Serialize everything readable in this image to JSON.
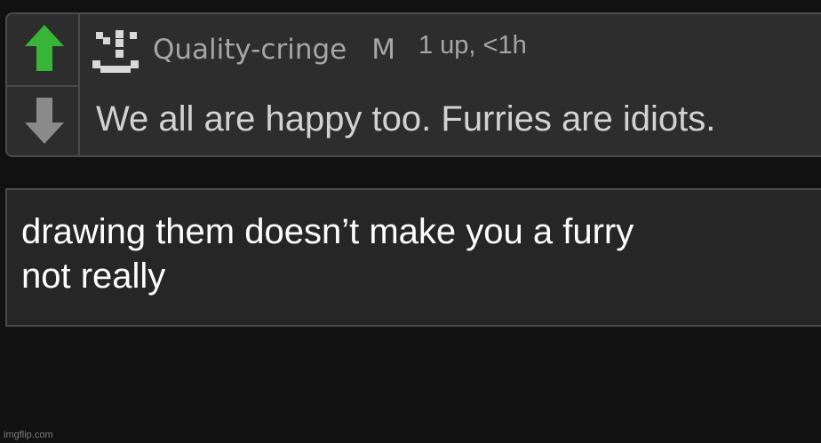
{
  "colors": {
    "background": "#111111",
    "panel": "#2d2d2d",
    "border": "#4a4a4a",
    "upvote_arrow": "#38b536",
    "downvote_arrow": "#8a8a8a",
    "meta_text": "#a6a6a6",
    "comment_text": "#d2d2d2",
    "reply_text": "#ffffff"
  },
  "comment": {
    "upvote_icon": "arrow-up-icon",
    "downvote_icon": "arrow-down-icon",
    "avatar_icon": "pixel-face-avatar",
    "username": "Quality-cringe",
    "flag": "M",
    "time": "1 up, <1h",
    "text": "We all are happy too. Furries are idiots."
  },
  "reply": {
    "line1": "drawing them doesn’t make you a furry",
    "line2": "not really"
  },
  "watermark": "imgflip.com"
}
